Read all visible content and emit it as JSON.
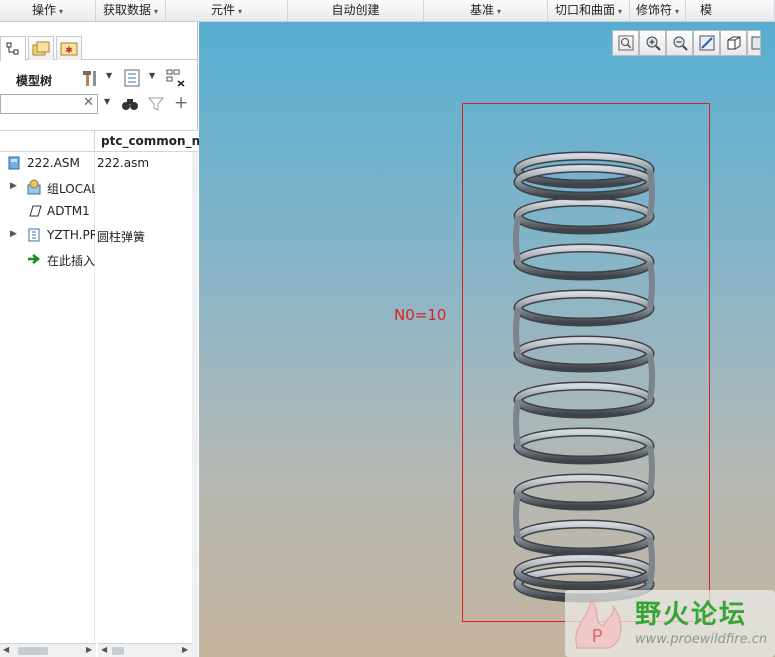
{
  "ribbon": {
    "groups": [
      {
        "label": "操作",
        "caret": "▾"
      },
      {
        "label": "获取数据",
        "caret": "▾"
      },
      {
        "label": "元件",
        "caret": "▾"
      },
      {
        "label": "自动创建",
        "caret": ""
      },
      {
        "label": "基准",
        "caret": "▾"
      },
      {
        "label": "切口和曲面",
        "caret": "▾"
      },
      {
        "label": "修饰符",
        "caret": "▾"
      },
      {
        "label": "模",
        "caret": ""
      }
    ]
  },
  "left_panel": {
    "tabs": [
      "model-tree-tab",
      "folder-browser-tab",
      "favorites-tab"
    ],
    "tree_title": "模型树",
    "search": {
      "value": "",
      "placeholder": ""
    },
    "column_header": "ptc_common_n",
    "rows": [
      {
        "name": "222.ASM",
        "value": "222.asm",
        "icon": "assembly-icon",
        "expandable": false
      },
      {
        "name": "组LOCAL",
        "value": "",
        "icon": "group-icon",
        "expandable": true
      },
      {
        "name": "ADTM1",
        "value": "",
        "icon": "datum-plane-icon",
        "expandable": false
      },
      {
        "name": "YZTH.PR",
        "value": "圆柱弹簧",
        "icon": "part-icon",
        "expandable": true
      },
      {
        "name": "在此插入",
        "value": "",
        "icon": "insert-here-icon",
        "expandable": false
      }
    ]
  },
  "viewport": {
    "annotation": "N0=10",
    "model": "helical-compression-spring",
    "coil_count": 10,
    "toolbar": [
      "zoom-fit-icon",
      "zoom-in-icon",
      "zoom-out-icon",
      "repaint-icon",
      "display-style-icon",
      "saved-views-icon"
    ],
    "colors": {
      "selection_box": "#e02020",
      "annotation": "#e02020",
      "spring": "#8d949c"
    }
  },
  "watermark": {
    "title": "野火论坛",
    "url": "www.proewildfire.cn"
  }
}
